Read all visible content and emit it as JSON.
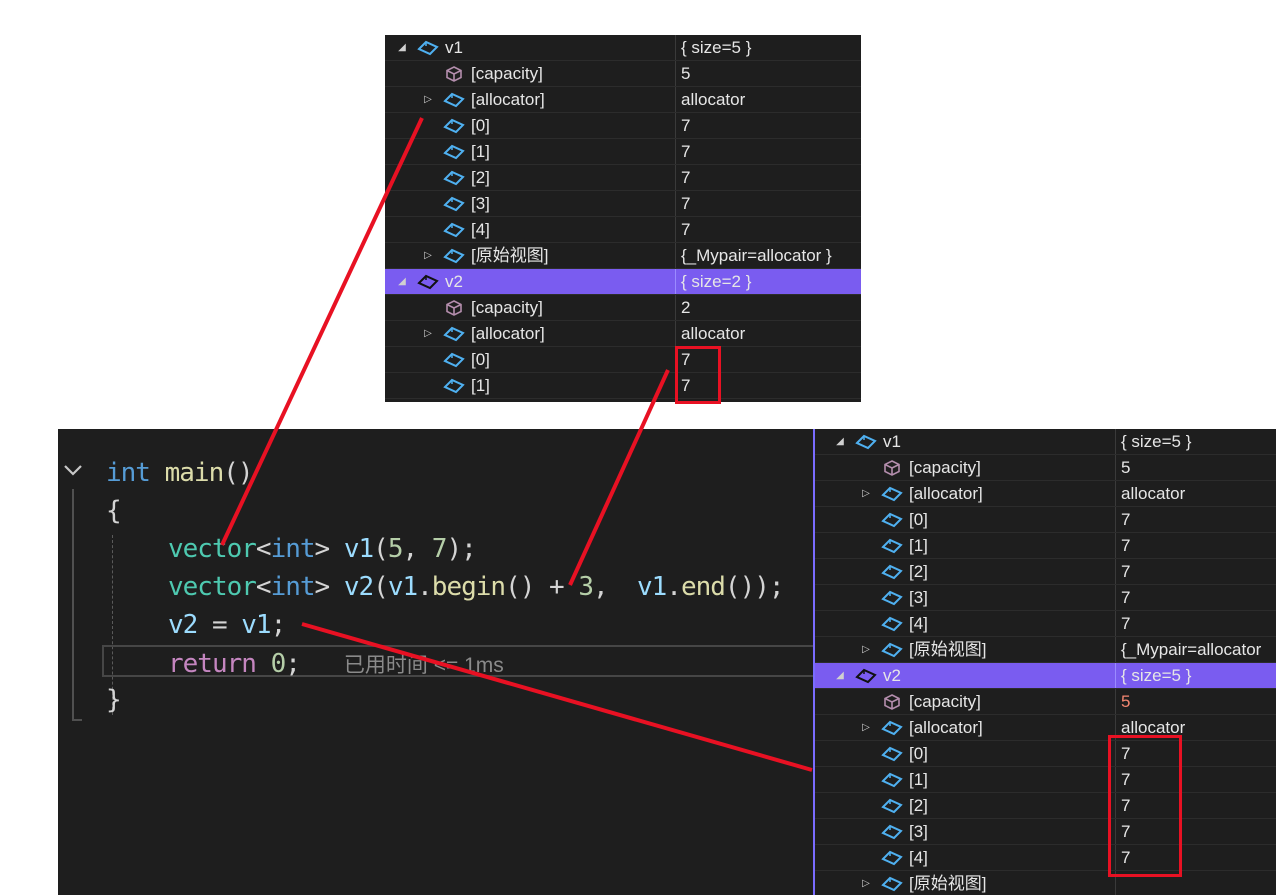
{
  "editor": {
    "code": {
      "l1": {
        "t1": "int",
        "t2": "main",
        "t3": "()"
      },
      "l2": {
        "t1": "{"
      },
      "l3": {
        "t1": "vector",
        "t2": "<",
        "t3": "int",
        "t4": ">",
        "t5": "v1",
        "t6": "(",
        "t7": "5",
        "t8": ", ",
        "t9": "7",
        "t10": ");"
      },
      "l4": {
        "t1": "vector",
        "t2": "<",
        "t3": "int",
        "t4": ">",
        "t5": "v2",
        "t6": "(",
        "t7": "v1",
        "t8": ".",
        "t9": "begin",
        "t10": "()",
        "t11": " + ",
        "t12": "3",
        "t13": ",  ",
        "t14": "v1",
        "t15": ".",
        "t16": "end",
        "t17": "());"
      },
      "l5": {
        "t1": "v2",
        "t2": " = ",
        "t3": "v1",
        "t4": ";"
      },
      "l6": {
        "t1": "return",
        "t2": " ",
        "t3": "0",
        "t4": ";"
      },
      "l7": {
        "t1": "}"
      }
    },
    "elapsed_hint": "已用时间 <= 1ms",
    "fold_icon": "chevron-down-icon"
  },
  "watch_top": {
    "rows": [
      {
        "name": "v1",
        "value": "{ size=5 }"
      },
      {
        "name": "[capacity]",
        "value": "5"
      },
      {
        "name": "[allocator]",
        "value": "allocator"
      },
      {
        "name": "[0]",
        "value": "7"
      },
      {
        "name": "[1]",
        "value": "7"
      },
      {
        "name": "[2]",
        "value": "7"
      },
      {
        "name": "[3]",
        "value": "7"
      },
      {
        "name": "[4]",
        "value": "7"
      },
      {
        "name": "[原始视图]",
        "value": "{_Mypair=allocator }"
      },
      {
        "name": "v2",
        "value": "{ size=2 }"
      },
      {
        "name": "[capacity]",
        "value": "2"
      },
      {
        "name": "[allocator]",
        "value": "allocator"
      },
      {
        "name": "[0]",
        "value": "7"
      },
      {
        "name": "[1]",
        "value": "7"
      }
    ]
  },
  "watch_bottom": {
    "rows": [
      {
        "name": "v1",
        "value": "{ size=5 }"
      },
      {
        "name": "[capacity]",
        "value": "5"
      },
      {
        "name": "[allocator]",
        "value": "allocator"
      },
      {
        "name": "[0]",
        "value": "7"
      },
      {
        "name": "[1]",
        "value": "7"
      },
      {
        "name": "[2]",
        "value": "7"
      },
      {
        "name": "[3]",
        "value": "7"
      },
      {
        "name": "[4]",
        "value": "7"
      },
      {
        "name": "[原始视图]",
        "value": "{_Mypair=allocator"
      },
      {
        "name": "v2",
        "value": "{ size=5 }"
      },
      {
        "name": "[capacity]",
        "value": "5"
      },
      {
        "name": "[allocator]",
        "value": "allocator"
      },
      {
        "name": "[0]",
        "value": "7"
      },
      {
        "name": "[1]",
        "value": "7"
      },
      {
        "name": "[2]",
        "value": "7"
      },
      {
        "name": "[3]",
        "value": "7"
      },
      {
        "name": "[4]",
        "value": "7"
      },
      {
        "name": "[原始视图]",
        "value": ""
      }
    ]
  },
  "colors": {
    "annotation_red": "#e81123",
    "selection": "#7a5cf0",
    "changed_value": "#f48771"
  }
}
